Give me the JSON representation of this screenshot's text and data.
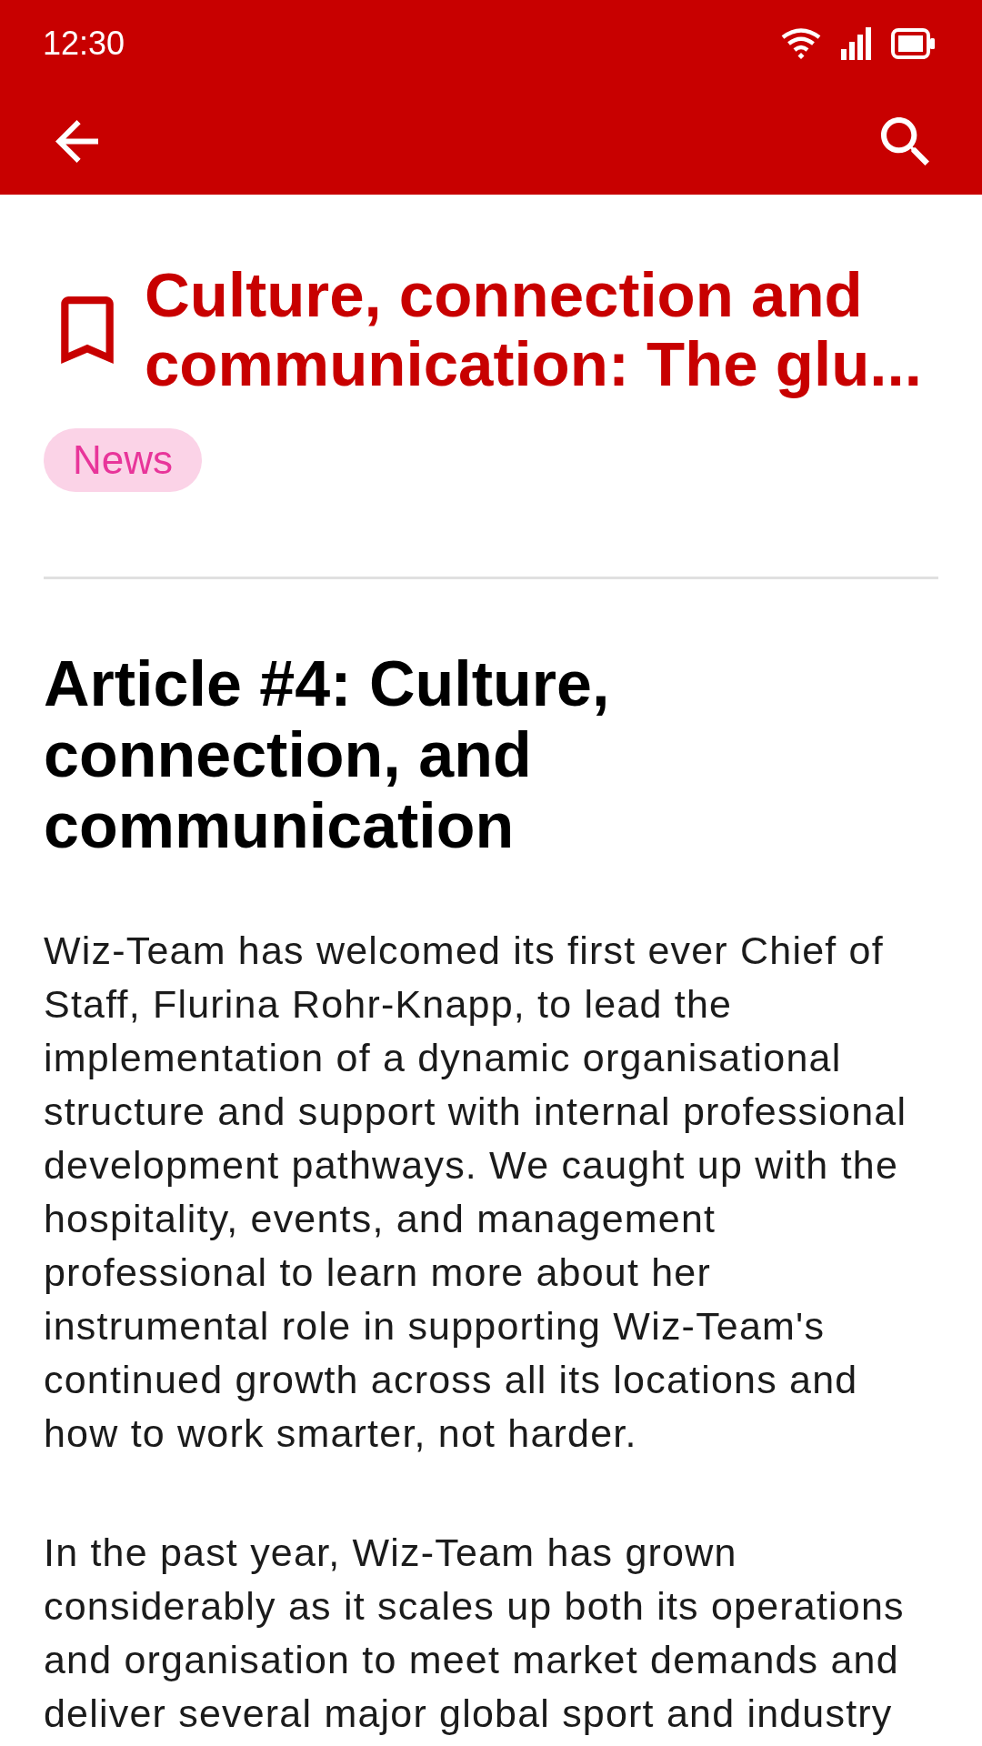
{
  "status_bar": {
    "time": "12:30"
  },
  "article": {
    "bookmarked": false,
    "title": "Culture, connection and communication: The glu...",
    "tag": "News",
    "heading": "Article #4: Culture, connection, and communication",
    "paragraphs": [
      "Wiz-Team has welcomed its first ever Chief of Staff, Flurina Rohr-Knapp, to lead the implementation of a dynamic organisational structure and support with internal professional development pathways. We caught up with the hospitality, events, and management professional to learn more about her instrumental role in supporting Wiz-Team's continued growth across all its locations and how to work smarter, not harder.",
      "In the past year, Wiz-Team has grown considerably as it scales up both its operations and organisation to meet market demands and deliver several major global sport and industry"
    ]
  }
}
